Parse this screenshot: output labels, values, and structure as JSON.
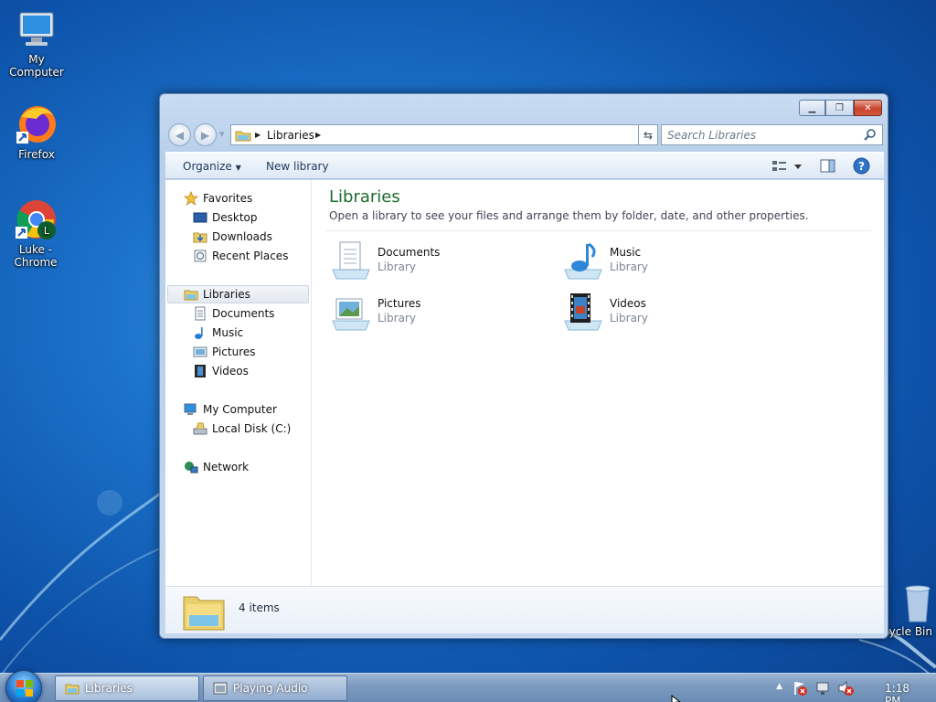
{
  "desktop": {
    "icons": [
      {
        "label": "My Computer",
        "icon": "computer-icon"
      },
      {
        "label": "Firefox",
        "icon": "firefox-icon"
      },
      {
        "label": "Luke - Chrome",
        "icon": "chrome-icon",
        "badge": "L"
      },
      {
        "label": "cycle Bin",
        "icon": "recycle-bin-icon"
      }
    ]
  },
  "window": {
    "title": "",
    "address": {
      "crumb": "Libraries"
    },
    "search": {
      "placeholder": "Search Libraries"
    },
    "toolbar": {
      "organize": "Organize",
      "new_library": "New library"
    },
    "nav": {
      "favorites": {
        "label": "Favorites",
        "items": [
          "Desktop",
          "Downloads",
          "Recent Places"
        ]
      },
      "libraries": {
        "label": "Libraries",
        "items": [
          "Documents",
          "Music",
          "Pictures",
          "Videos"
        ]
      },
      "computer": {
        "label": "My Computer",
        "items": [
          "Local Disk (C:)"
        ]
      },
      "network": {
        "label": "Network"
      }
    },
    "main": {
      "title": "Libraries",
      "description": "Open a library to see your files and arrange them by folder, date, and other properties.",
      "items": [
        {
          "name": "Documents",
          "type": "Library",
          "icon": "documents-library-icon"
        },
        {
          "name": "Music",
          "type": "Library",
          "icon": "music-library-icon"
        },
        {
          "name": "Pictures",
          "type": "Library",
          "icon": "pictures-library-icon"
        },
        {
          "name": "Videos",
          "type": "Library",
          "icon": "videos-library-icon"
        }
      ]
    },
    "details": {
      "count": "4 items"
    }
  },
  "taskbar": {
    "buttons": [
      {
        "label": "Libraries",
        "icon": "libraries-icon"
      },
      {
        "label": "Playing Audio",
        "icon": "audio-window-icon"
      }
    ],
    "tray": {
      "time": "1:18 PM"
    }
  },
  "colors": {
    "accent": "#1e6c2f",
    "selection": "#e3e9f1"
  }
}
